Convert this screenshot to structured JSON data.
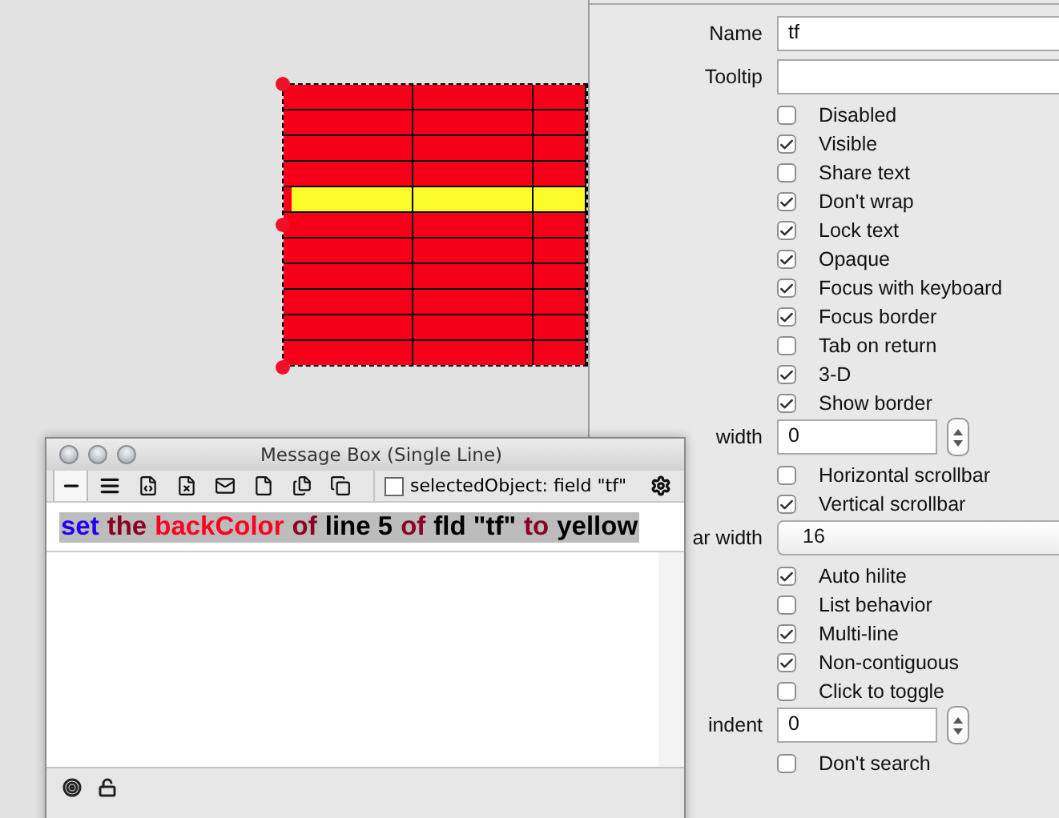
{
  "canvas_field": {
    "rows": [
      {
        "selected": false
      },
      {
        "selected": false
      },
      {
        "selected": false
      },
      {
        "selected": false
      },
      {
        "selected": true
      },
      {
        "selected": false
      },
      {
        "selected": false
      },
      {
        "selected": false
      },
      {
        "selected": false
      },
      {
        "selected": false
      },
      {
        "selected": false
      }
    ]
  },
  "inspector": {
    "rows": [
      {
        "kind": "field",
        "label": "Name",
        "value": "tf"
      },
      {
        "kind": "field",
        "label": "Tooltip",
        "value": ""
      },
      {
        "kind": "checkbox",
        "label": "Disabled",
        "checked": false
      },
      {
        "kind": "checkbox",
        "label": "Visible",
        "checked": true
      },
      {
        "kind": "checkbox",
        "label": "Share text",
        "checked": false
      },
      {
        "kind": "checkbox",
        "label": "Don't wrap",
        "checked": true
      },
      {
        "kind": "checkbox",
        "label": "Lock text",
        "checked": true
      },
      {
        "kind": "checkbox",
        "label": "Opaque",
        "checked": true
      },
      {
        "kind": "checkbox",
        "label": "Focus with keyboard",
        "checked": true
      },
      {
        "kind": "checkbox",
        "label": "Focus border",
        "checked": true
      },
      {
        "kind": "checkbox",
        "label": "Tab on return",
        "checked": false
      },
      {
        "kind": "checkbox",
        "label": "3-D",
        "checked": true
      },
      {
        "kind": "checkbox",
        "label": "Show border",
        "checked": true
      },
      {
        "kind": "stepper",
        "label": "width",
        "value": "0"
      },
      {
        "kind": "checkbox",
        "label": "Horizontal scrollbar",
        "checked": false
      },
      {
        "kind": "checkbox",
        "label": "Vertical scrollbar",
        "checked": true
      },
      {
        "kind": "popup",
        "label": "ar width",
        "value": "16"
      },
      {
        "kind": "checkbox",
        "label": "Auto hilite",
        "checked": true
      },
      {
        "kind": "checkbox",
        "label": "List behavior",
        "checked": false
      },
      {
        "kind": "checkbox",
        "label": "Multi-line",
        "checked": true
      },
      {
        "kind": "checkbox",
        "label": "Non-contiguous",
        "checked": true
      },
      {
        "kind": "checkbox",
        "label": "Click to toggle",
        "checked": false
      },
      {
        "kind": "stepper",
        "label": "indent",
        "value": "0"
      },
      {
        "kind": "checkbox",
        "label": "Don't search",
        "checked": false
      }
    ]
  },
  "message_box": {
    "title": "Message Box (Single Line)",
    "tools": [
      {
        "selected": true
      },
      {
        "selected": false
      },
      {
        "selected": false
      },
      {
        "selected": false
      },
      {
        "selected": false
      },
      {
        "selected": false
      },
      {
        "selected": false
      },
      {
        "selected": false
      }
    ],
    "selected_object": {
      "label": "selectedObject: field \"tf\"",
      "checked": false
    },
    "command": [
      {
        "text": "set",
        "color": "#2200ee"
      },
      {
        "text": "the",
        "color": "#8a0022"
      },
      {
        "text": "backColor",
        "color": "#ff0020"
      },
      {
        "text": "of",
        "color": "#8a0022"
      },
      {
        "text": "line 5",
        "color": "#000000"
      },
      {
        "text": "of",
        "color": "#8a0022"
      },
      {
        "text": "fld \"tf\"",
        "color": "#000000"
      },
      {
        "text": "to",
        "color": "#8a0022"
      },
      {
        "text": "yellow",
        "color": "#000000"
      }
    ]
  }
}
